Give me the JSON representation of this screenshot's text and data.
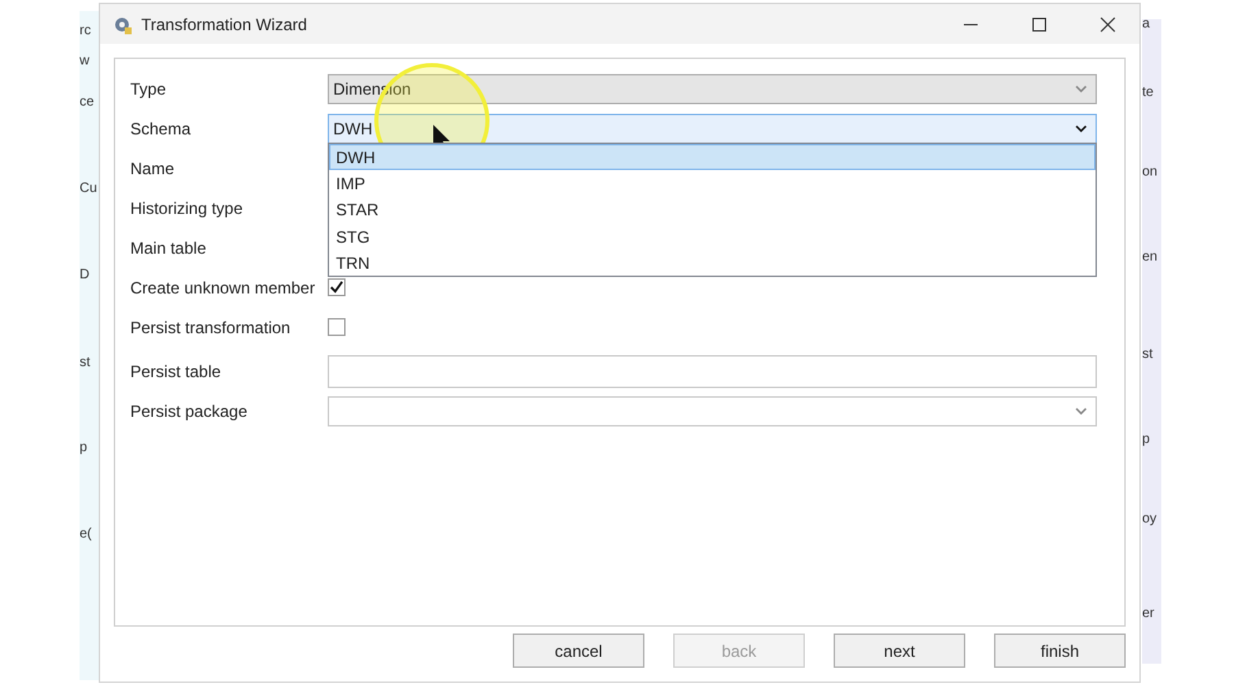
{
  "background_window": {
    "left_fragments": [
      "rc",
      "w",
      "ce",
      "Cu",
      "D",
      "st",
      "p",
      "e("
    ],
    "right_fragments": [
      "a",
      "te",
      "on",
      "en",
      "st",
      "p",
      "oy",
      "er"
    ]
  },
  "window": {
    "title": "Transformation Wizard"
  },
  "fields": [
    {
      "label": "Type",
      "kind": "dropdown",
      "value": "Dimension"
    },
    {
      "label": "Schema",
      "kind": "combo",
      "value": "DWH",
      "expanded": true,
      "options": [
        {
          "label": "DWH",
          "selected": true
        },
        {
          "label": "IMP",
          "selected": false
        },
        {
          "label": "STAR",
          "selected": false
        },
        {
          "label": "STG",
          "selected": false
        },
        {
          "label": "TRN",
          "selected": false
        }
      ]
    },
    {
      "label": "Name",
      "kind": "label"
    },
    {
      "label": "Historizing type",
      "kind": "label"
    },
    {
      "label": "Main table",
      "kind": "label"
    },
    {
      "label": "Create unknown member",
      "kind": "checkbox",
      "checked": true
    },
    {
      "label": "Persist transformation",
      "kind": "checkbox",
      "checked": false
    },
    {
      "label": "Persist table",
      "kind": "text"
    },
    {
      "label": "Persist package",
      "kind": "combo",
      "expanded": false
    }
  ],
  "buttons": [
    {
      "label": "cancel",
      "disabled": false
    },
    {
      "label": "back",
      "disabled": true
    },
    {
      "label": "next",
      "disabled": false
    },
    {
      "label": "finish",
      "disabled": false
    }
  ]
}
